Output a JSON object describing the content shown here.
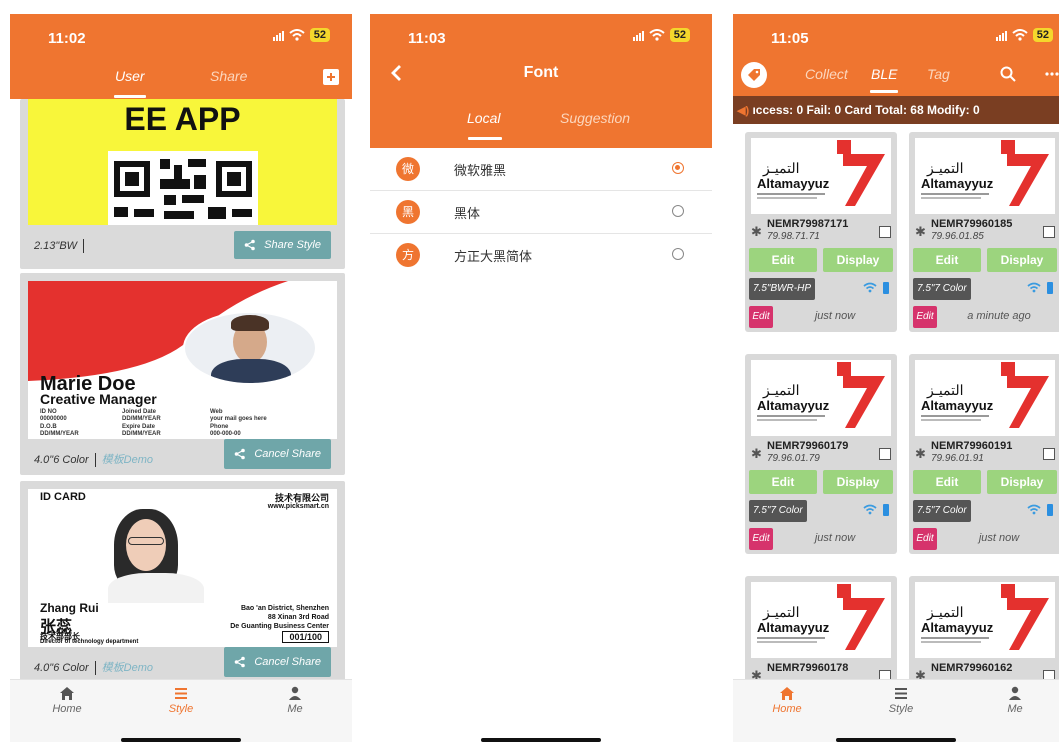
{
  "colors": {
    "primary": "#EF7530",
    "ticker": "#7A3E22",
    "edit_btn": "#9CD47E",
    "share_btn": "#6FA6A9",
    "alert": "#D6336C",
    "battery": "#F5D72C"
  },
  "phones": [
    {
      "time": "11:02",
      "battery": "52",
      "tabs": [
        "User",
        "Share"
      ],
      "active_tab": "User",
      "cards": [
        {
          "banner": "EE APP",
          "size": "2.13\"BW",
          "demo": "",
          "button": "Share Style"
        },
        {
          "name": "Marie Doe",
          "role": "Creative Manager",
          "fields": [
            [
              "ID NO",
              "00000000"
            ],
            [
              "Joined Date",
              "DD/MM/YEAR"
            ],
            [
              "Web",
              "your mail goes here"
            ],
            [
              "D.O.B",
              "DD/MM/YEAR"
            ],
            [
              "Expire Date",
              "DD/MM/YEAR"
            ],
            [
              "Phone",
              "000-000-00"
            ]
          ],
          "size": "4.0\"6 Color",
          "demo": "模板Demo",
          "button": "Cancel Share"
        },
        {
          "header": "ID CARD",
          "company": "技术有限公司",
          "website": "www.picksmart.cn",
          "name_en": "Zhang Rui",
          "name_cn": "张蕊",
          "dept_cn": "技术部部长",
          "dept_en": "Director of technology department",
          "addr1": "Bao 'an District, Shenzhen",
          "addr2": "88 Xinan 3rd Road",
          "addr3": "De Guanting Business Center",
          "badge": "001/100",
          "size": "4.0\"6 Color",
          "demo": "模板Demo",
          "button": "Cancel Share"
        }
      ],
      "nav": [
        "Home",
        "Style",
        "Me"
      ],
      "nav_active": "Style"
    },
    {
      "time": "11:03",
      "battery": "52",
      "title": "Font",
      "tabs": [
        "Local",
        "Suggestion"
      ],
      "active_tab": "Local",
      "fonts": [
        {
          "badge": "微",
          "name": "微软雅黑",
          "selected": true
        },
        {
          "badge": "黑",
          "name": "黑体",
          "selected": false
        },
        {
          "badge": "方",
          "name": "方正大黑简体",
          "selected": false
        }
      ]
    },
    {
      "time": "11:05",
      "battery": "52",
      "tabs": [
        "Collect",
        "BLE",
        "Tag"
      ],
      "active_tab": "BLE",
      "ticker": "ıccess: 0 Fail: 0    Card Total: 68 Modify: 0",
      "devices": [
        {
          "name": "NEMR79987171",
          "ip": "79.98.71.71",
          "type": "7.5\"BWR-HP",
          "time": "just now"
        },
        {
          "name": "NEMR79960185",
          "ip": "79.96.01.85",
          "type": "7.5\"7 Color",
          "time": "a minute ago"
        },
        {
          "name": "NEMR79960179",
          "ip": "79.96.01.79",
          "type": "7.5\"7 Color",
          "time": "just now"
        },
        {
          "name": "NEMR79960191",
          "ip": "79.96.01.91",
          "type": "7.5\"7 Color",
          "time": "just now"
        },
        {
          "name": "NEMR79960178",
          "ip": "",
          "type": "",
          "time": ""
        },
        {
          "name": "NEMR79960162",
          "ip": "",
          "type": "",
          "time": ""
        }
      ],
      "logo": {
        "ar": "التميـز",
        "en": "Altamayyuz"
      },
      "edit": "Edit",
      "display": "Display",
      "nav": [
        "Home",
        "Style",
        "Me"
      ],
      "nav_active": "Home"
    }
  ]
}
